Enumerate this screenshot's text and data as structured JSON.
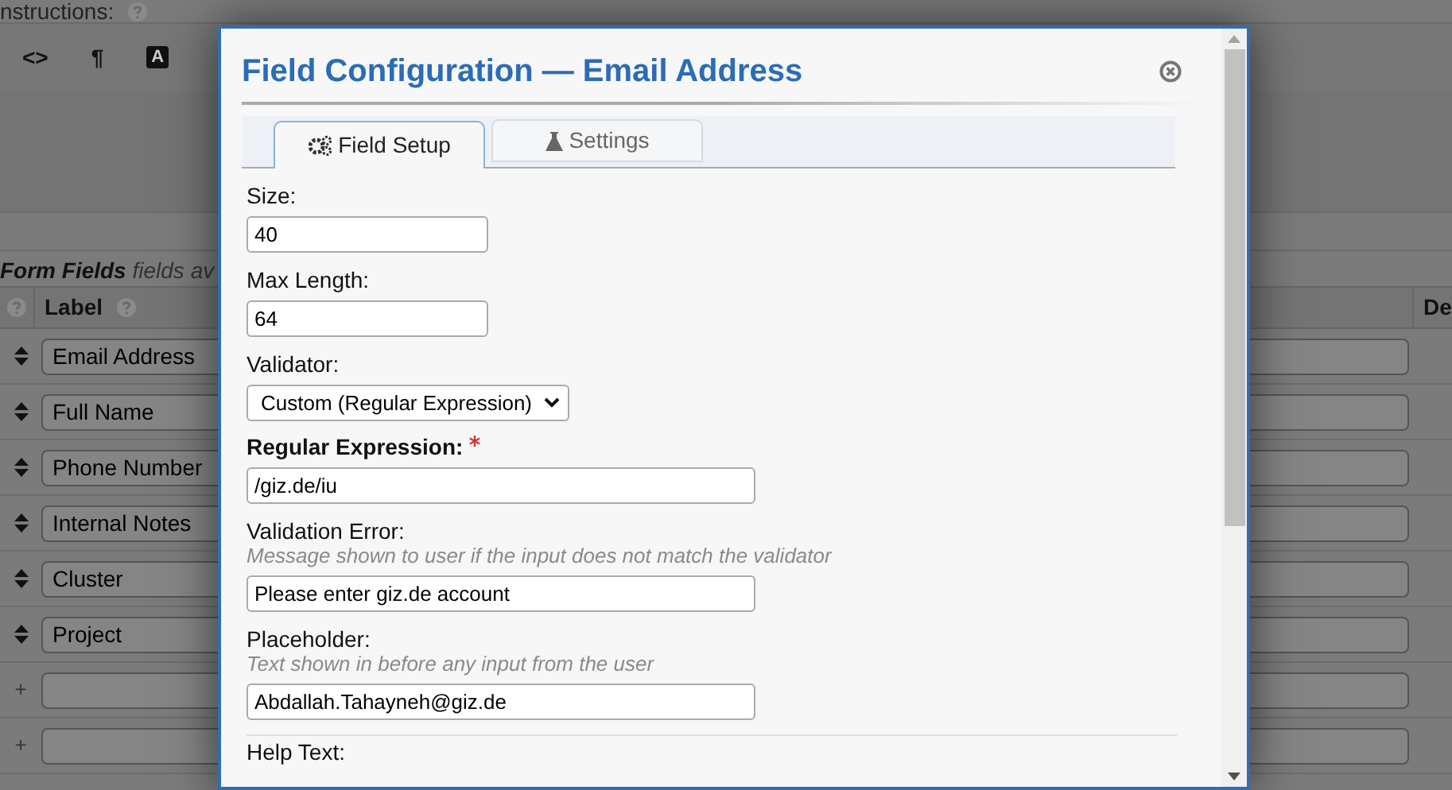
{
  "page": {
    "instructions_label": "nstructions:",
    "toolbar": [
      "<>",
      "¶",
      "A"
    ],
    "form_fields": {
      "title": "Form Fields",
      "note": "fields av"
    },
    "table": {
      "columns": [
        "Label",
        "De"
      ],
      "rows": [
        {
          "kind": "sort",
          "value": "Email Address"
        },
        {
          "kind": "sort",
          "value": "Full Name"
        },
        {
          "kind": "sort",
          "value": "Phone Number"
        },
        {
          "kind": "sort",
          "value": "Internal Notes"
        },
        {
          "kind": "sort",
          "value": "Cluster"
        },
        {
          "kind": "sort",
          "value": "Project"
        },
        {
          "kind": "add",
          "handle": "+"
        },
        {
          "kind": "add",
          "handle": "+"
        }
      ]
    }
  },
  "dialog": {
    "title": "Field Configuration — Email Address",
    "tabs": [
      {
        "label": "Field Setup",
        "selected": true
      },
      {
        "label": "Settings",
        "selected": false
      }
    ],
    "fields": [
      {
        "kind": "text",
        "label": "Size:",
        "required": false,
        "value": "40"
      },
      {
        "kind": "text",
        "label": "Max Length:",
        "required": false,
        "value": "64"
      },
      {
        "kind": "select",
        "label": "Validator:",
        "required": false,
        "value": "Custom (Regular Expression)"
      },
      {
        "kind": "wide_text",
        "label": "Regular Expression:",
        "required": true,
        "value": "/giz.de/iu"
      },
      {
        "kind": "wide_text",
        "label": "Validation Error:",
        "required": false,
        "hint": "Message shown to user if the input does not match the validator",
        "value": "Please enter giz.de account"
      },
      {
        "kind": "wide_text",
        "label": "Placeholder:",
        "required": false,
        "hint": "Text shown in before any input from the user",
        "value": "Abdallah.Tahayneh@giz.de"
      },
      {
        "kind": "cut",
        "label": "Help Text:"
      }
    ]
  }
}
